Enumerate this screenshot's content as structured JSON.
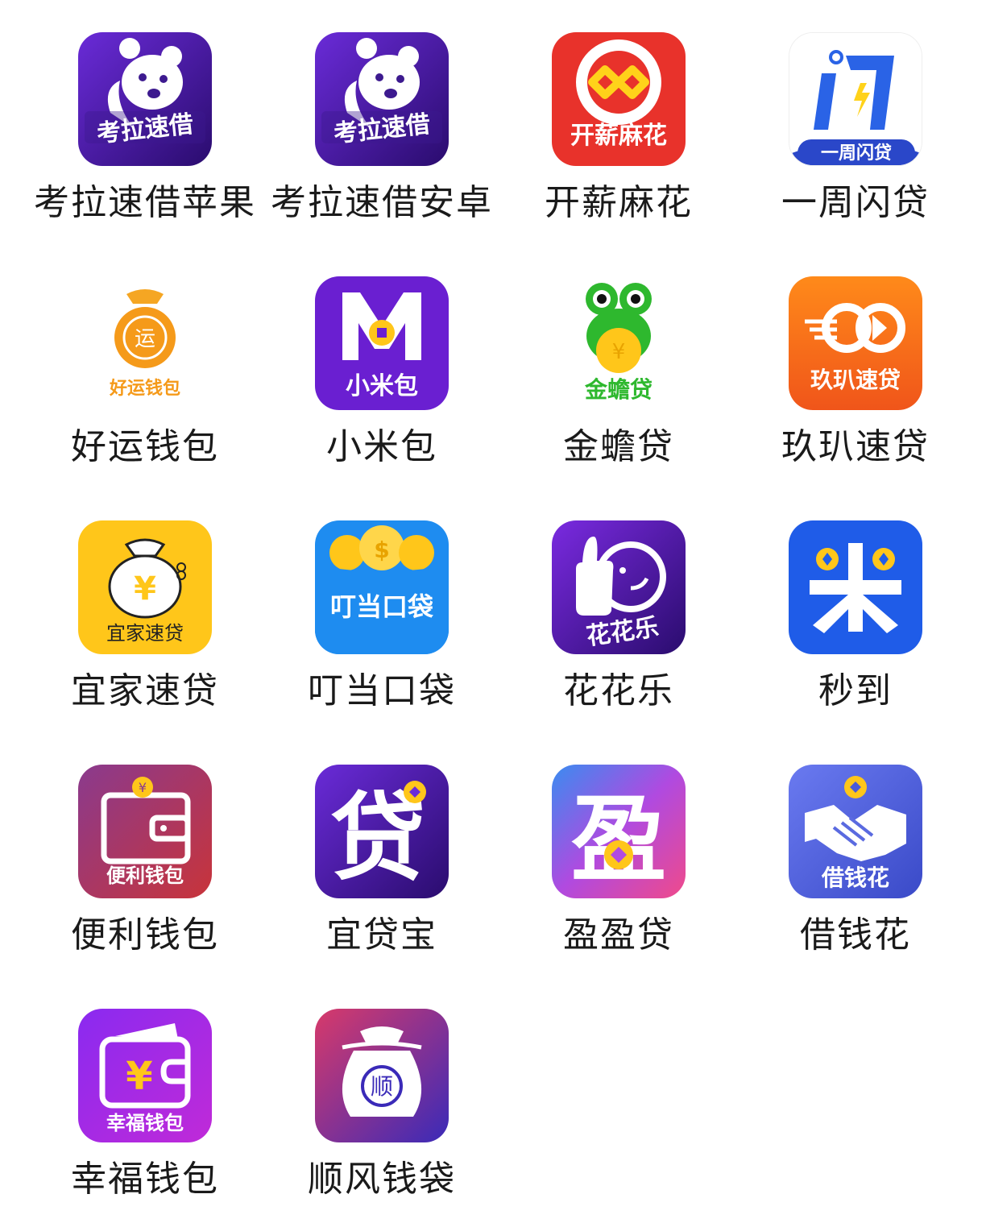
{
  "apps": [
    {
      "label": "考拉速借苹果",
      "icon_text": "考拉速借",
      "icon": "koala-icon"
    },
    {
      "label": "考拉速借安卓",
      "icon_text": "考拉速借",
      "icon": "koala-icon"
    },
    {
      "label": "开薪麻花",
      "icon_text": "开薪麻花",
      "icon": "infinity-ring-icon"
    },
    {
      "label": "一周闪贷",
      "icon_text": "一周闪贷",
      "icon": "lightning-door-icon"
    },
    {
      "label": "好运钱包",
      "icon_text": "好运钱包",
      "icon": "money-bag-icon"
    },
    {
      "label": "小米包",
      "icon_text": "小米包",
      "icon": "m-coin-icon"
    },
    {
      "label": "金蟾贷",
      "icon_text": "金蟾贷",
      "icon": "frog-coin-icon"
    },
    {
      "label": "玖玐速贷",
      "icon_text": "玖玐速贷",
      "icon": "arrow-rings-icon"
    },
    {
      "label": "宜家速贷",
      "icon_text": "宜家速贷",
      "icon": "yuan-bag-icon"
    },
    {
      "label": "叮当口袋",
      "icon_text": "叮当口袋",
      "icon": "coins-pocket-icon"
    },
    {
      "label": "花花乐",
      "icon_text": "花花乐",
      "icon": "thumbs-up-smile-icon"
    },
    {
      "label": "秒到",
      "icon_text": "",
      "icon": "rice-coins-icon"
    },
    {
      "label": "便利钱包",
      "icon_text": "便利钱包",
      "icon": "wallet-icon"
    },
    {
      "label": "宜贷宝",
      "icon_text": "贷",
      "icon": "dai-character-icon"
    },
    {
      "label": "盈盈贷",
      "icon_text": "盈",
      "icon": "ying-character-icon"
    },
    {
      "label": "借钱花",
      "icon_text": "借钱花",
      "icon": "handshake-coin-icon"
    },
    {
      "label": "幸福钱包",
      "icon_text": "幸福钱包",
      "icon": "yuan-wallet-icon"
    },
    {
      "label": "顺风钱袋",
      "icon_text": "顺",
      "icon": "shun-bag-icon"
    }
  ],
  "colors": {
    "purple_dark": "#3d1a8f",
    "purple": "#6a2bd8",
    "red": "#e8322b",
    "blue": "#2a63e6",
    "orange": "#f59a1a",
    "yellow": "#ffc61a",
    "green": "#2eb82e"
  }
}
